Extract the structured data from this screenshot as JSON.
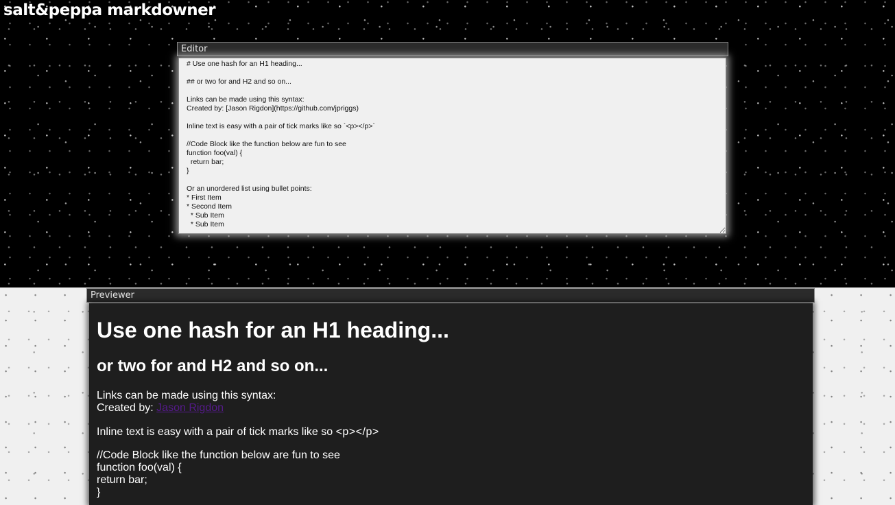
{
  "app": {
    "title": "salt&peppa markdowner"
  },
  "editor": {
    "header": "Editor",
    "content": "# Use one hash for an H1 heading...\n\n## or two for and H2 and so on...\n\nLinks can be made using this syntax:\nCreated by: [Jason Rigdon](https://github.com/jpriggs)\n\nInline text is easy with a pair of tick marks like so `<p></p>`\n\n//Code Block like the function below are fun to see\nfunction foo(val) {\n  return bar;\n}\n\nOr an unordered list using bullet points:\n* First Item\n* Second Item\n  * Sub Item\n  * Sub Item"
  },
  "previewer": {
    "header": "Previewer",
    "h1": "Use one hash for an H1 heading...",
    "h2": "or two for and H2 and so on...",
    "links_line": "Links can be made using this syntax:",
    "created_by": "Created by:",
    "link_text": "Jason Rigdon",
    "inline_text": "Inline text is easy with a pair of tick marks like so",
    "inline_code": "<p></p>",
    "code_comment": "//Code Block like the function below are fun to see",
    "code_line1": "function foo(val) {",
    "code_line2": "return bar;",
    "code_line3": "}"
  },
  "colors": {
    "link": "#551a8b",
    "preview_bg": "#1e1e1e",
    "editor_bg": "#f0f0f0"
  }
}
